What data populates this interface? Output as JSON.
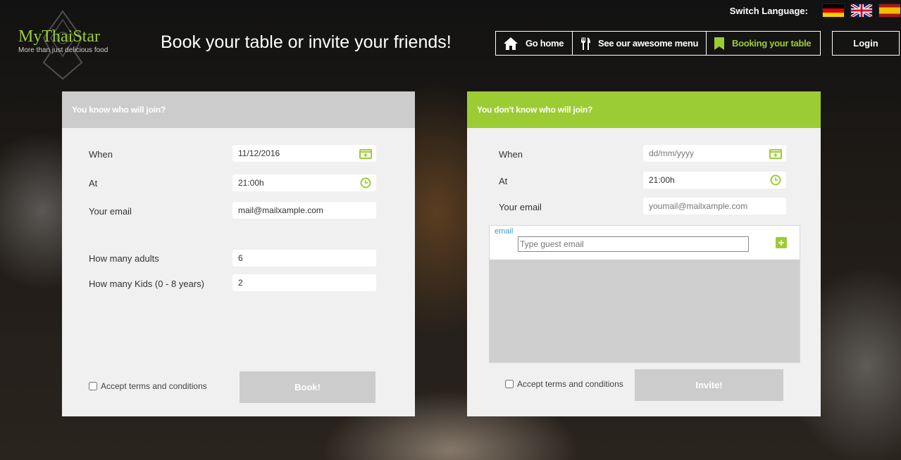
{
  "language": {
    "label": "Switch Language:",
    "flags": [
      "de-flag-icon",
      "uk-flag-icon",
      "es-flag-icon"
    ]
  },
  "logo": {
    "title": "MyThaiStar",
    "tagline": "More than just delicious food"
  },
  "headline": "Book your table or invite your friends!",
  "nav": {
    "home": "Go home",
    "menu": "See our awesome menu",
    "booking": "Booking your table",
    "login": "Login"
  },
  "colors": {
    "accent": "#9ccc34",
    "panel": "#f0f0f0",
    "muted": "#cccccc",
    "link": "#3a9ec2"
  },
  "book": {
    "header": "You know who will join?",
    "when_label": "When",
    "when_value": "11/12/2016",
    "at_label": "At",
    "at_value": "21:00h",
    "email_label": "Your email",
    "email_value": "mail@mailxample.com",
    "adults_label": "How many adults",
    "adults_value": "6",
    "kids_label": "How many Kids (0 - 8 years)",
    "kids_value": "2",
    "terms": "Accept terms and conditions",
    "submit": "Book!"
  },
  "invite": {
    "header": "You don't know who will join?",
    "when_label": "When",
    "when_placeholder": "dd/mm/yyyy",
    "at_label": "At",
    "at_value": "21:00h",
    "email_label": "Your email",
    "email_placeholder": "youmail@mailxample.com",
    "guest_label": "email",
    "guest_placeholder": "Type guest email",
    "terms": "Accept terms and conditions",
    "submit": "Invite!"
  }
}
